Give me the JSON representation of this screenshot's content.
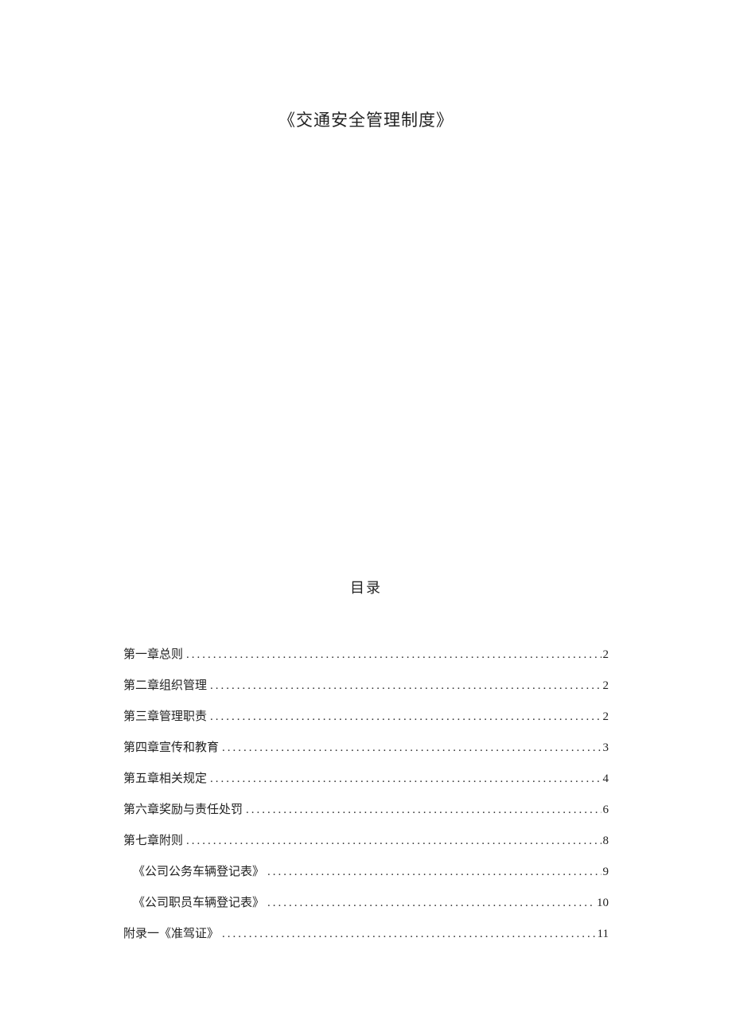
{
  "title": "《交通安全管理制度》",
  "toc_heading": "目录",
  "toc": [
    {
      "label": "第一章总则",
      "page": "2",
      "indent": false
    },
    {
      "label": "第二章组织管理",
      "page": "2",
      "indent": false
    },
    {
      "label": "第三章管理职责",
      "page": "2",
      "indent": false
    },
    {
      "label": "第四章宣传和教育",
      "page": "3",
      "indent": false
    },
    {
      "label": "第五章相关规定",
      "page": "4",
      "indent": false
    },
    {
      "label": "第六章奖励与责任处罚",
      "page": "6",
      "indent": false
    },
    {
      "label": "第七章附则",
      "page": "8",
      "indent": false
    },
    {
      "label": "《公司公务车辆登记表》",
      "page": "9",
      "indent": true
    },
    {
      "label": "《公司职员车辆登记表》",
      "page": "10",
      "indent": true
    },
    {
      "label": "附录一《准驾证》",
      "page": "11",
      "indent": false
    }
  ]
}
